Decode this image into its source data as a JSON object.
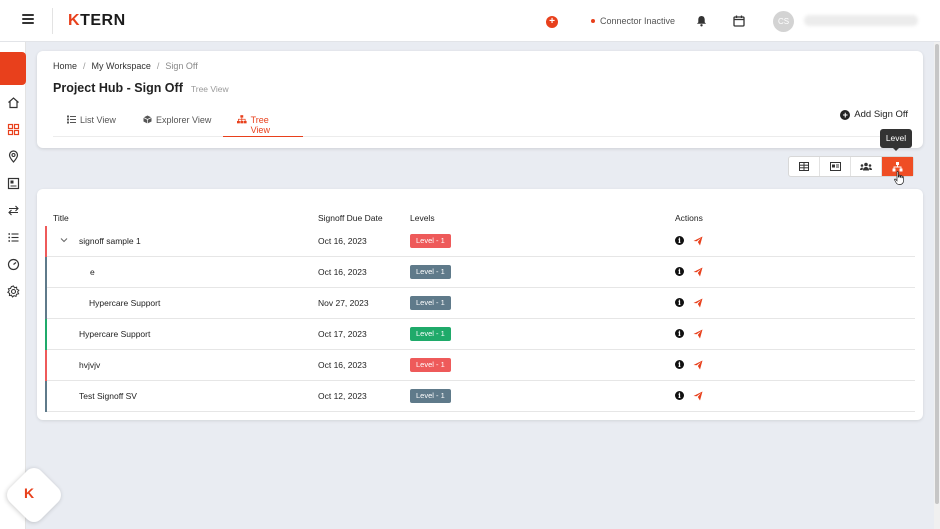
{
  "topbar": {
    "logo_accent": "K",
    "logo_rest": "TERN",
    "connector_status": "Connector Inactive",
    "avatar_initials": "CS"
  },
  "breadcrumb": {
    "home": "Home",
    "workspace": "My Workspace",
    "current": "Sign Off",
    "sep": "/"
  },
  "page": {
    "title": "Project Hub - Sign Off",
    "subtitle": "Tree View"
  },
  "tabs": [
    {
      "label": "List View",
      "icon": "list-icon"
    },
    {
      "label": "Explorer View",
      "icon": "cube-icon"
    },
    {
      "label": "Tree View",
      "icon": "sitemap-icon",
      "active": true
    }
  ],
  "actions": {
    "add_signoff_label": "Add Sign Off"
  },
  "tooltip": {
    "text": "Level"
  },
  "view_switcher": {
    "buttons": [
      "table-view-icon",
      "card-view-icon",
      "users-view-icon",
      "level-view-icon"
    ],
    "active_index": 3
  },
  "table": {
    "headers": {
      "title": "Title",
      "due_date": "Signoff Due Date",
      "levels": "Levels",
      "actions": "Actions"
    },
    "rows": [
      {
        "title": "signoff sample 1",
        "due": "Oct 16, 2023",
        "level": "Level - 1",
        "status": "red",
        "expandable": true,
        "indent": 0
      },
      {
        "title": "e",
        "due": "Oct 16, 2023",
        "level": "Level - 1",
        "status": "gray",
        "expandable": false,
        "indent": 1
      },
      {
        "title": "Hypercare Support",
        "due": "Nov 27, 2023",
        "level": "Level - 1",
        "status": "gray",
        "expandable": false,
        "indent": 1
      },
      {
        "title": "Hypercare Support",
        "due": "Oct 17, 2023",
        "level": "Level - 1",
        "status": "green",
        "expandable": false,
        "indent": 0
      },
      {
        "title": "hvjvjv",
        "due": "Oct 16, 2023",
        "level": "Level - 1",
        "status": "red",
        "expandable": false,
        "indent": 0
      },
      {
        "title": "Test Signoff SV",
        "due": "Oct 12, 2023",
        "level": "Level - 1",
        "status": "gray",
        "expandable": false,
        "indent": 0
      }
    ]
  },
  "colors": {
    "accent": "#e8401c",
    "red": "#ee5a5a",
    "gray": "#5f7a8a",
    "green": "#1faa6a",
    "bar_red": "#ee5a5a",
    "bar_gray": "#5f7a8a",
    "bar_green": "#1faa6a"
  },
  "fab": {
    "label": "K"
  }
}
